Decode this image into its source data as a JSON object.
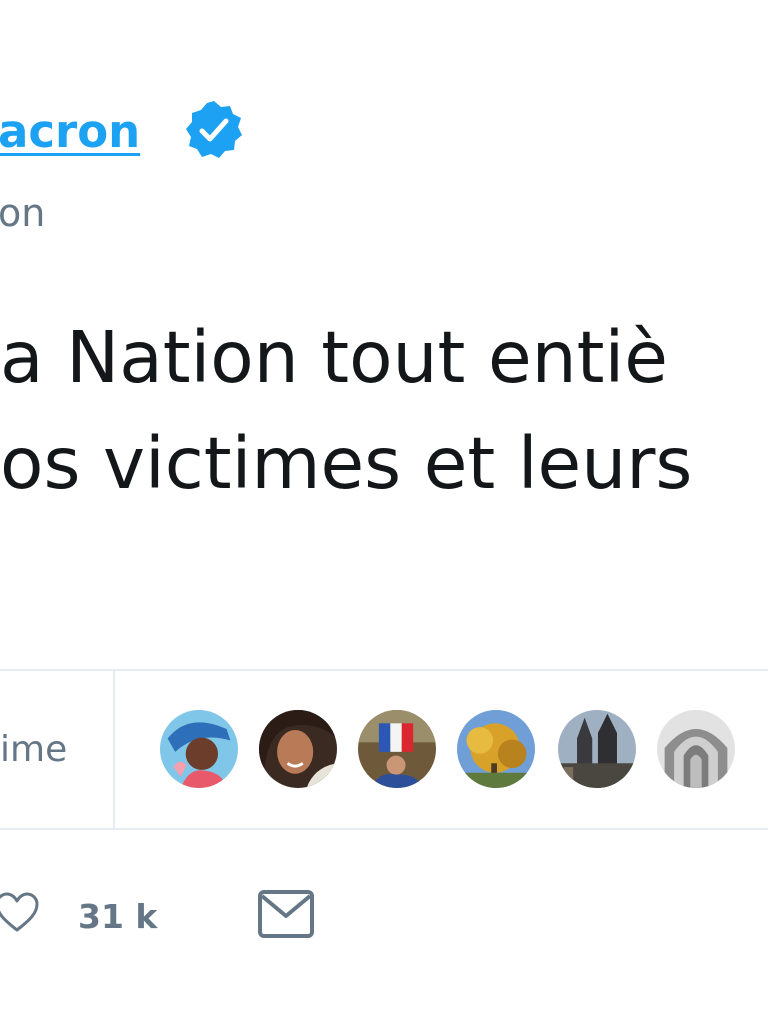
{
  "colors": {
    "link": "#1da1f2",
    "text": "#14171a",
    "secondary": "#657786",
    "divider": "#e6ecf0",
    "icon": "#657786"
  },
  "author": {
    "name_fragment": "acron",
    "handle_fragment": "on",
    "verified_icon": "verified-badge-icon"
  },
  "tweet": {
    "lines": [
      "a Nation tout entiè",
      "os victimes et leurs"
    ]
  },
  "likes_bar": {
    "label_fragment": "ime",
    "avatars": [
      "avatar-woman-headwrap",
      "avatar-smiling-woman",
      "avatar-flag-crowd",
      "avatar-autumn-tree",
      "avatar-cathedral",
      "avatar-arches"
    ]
  },
  "actions": {
    "like_icon": "heart-icon",
    "like_count": "31 k",
    "message_icon": "mail-icon"
  }
}
